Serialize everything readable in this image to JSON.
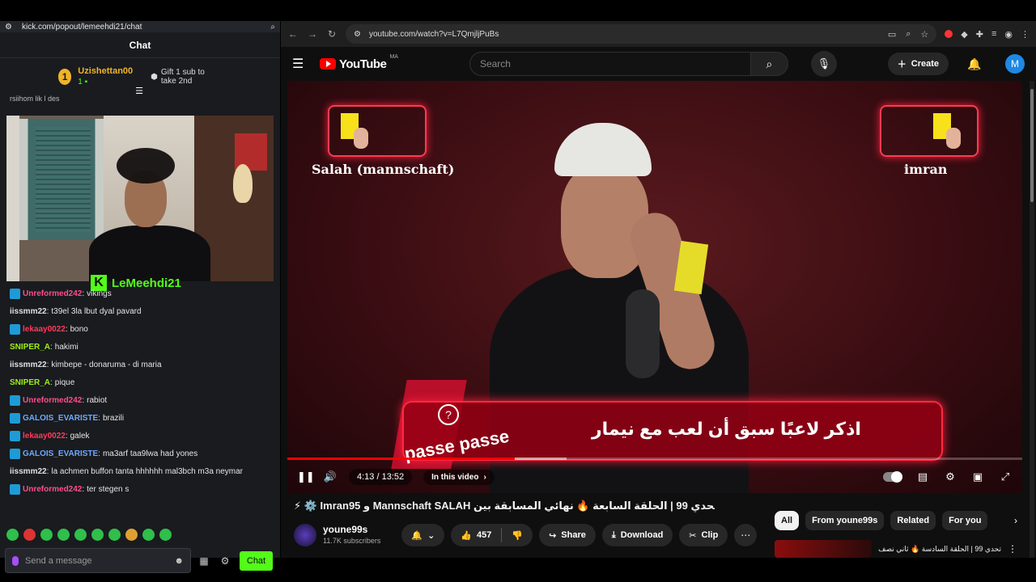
{
  "kick": {
    "url": "kick.com/popout/lemeehdi21/chat",
    "header_title": "Chat",
    "gift": {
      "rank": "1",
      "user": "Uzishettan00",
      "count": "1",
      "cta": "Gift 1 sub to take 2nd"
    },
    "cut_line": "rsiihom lik l des",
    "streamer_tag": "LeMeehdi21",
    "messages": [
      {
        "user": "Unreformed242",
        "text": "vikings",
        "color": "#ff4d8d",
        "badge": true
      },
      {
        "user": "iissmm22",
        "text": "t39el 3la lbut dyal pavard",
        "color": "#e0e0e0",
        "badge": false
      },
      {
        "user": "lekaay0022",
        "text": "bono",
        "color": "#ff3b5c",
        "badge": true
      },
      {
        "user": "SNIPER_A",
        "text": "hakimi",
        "color": "#9ef01a",
        "badge": false
      },
      {
        "user": "iissmm22",
        "text": "kimbepe - donaruma - di maria",
        "color": "#e0e0e0",
        "badge": false
      },
      {
        "user": "SNIPER_A",
        "text": "pique",
        "color": "#9ef01a",
        "badge": false
      },
      {
        "user": "Unreformed242",
        "text": "rabiot",
        "color": "#ff4d8d",
        "badge": true
      },
      {
        "user": "GALOIS_EVARISTE",
        "text": "brazili",
        "color": "#6fa8ff",
        "badge": true
      },
      {
        "user": "lekaay0022",
        "text": "galek",
        "color": "#ff3b5c",
        "badge": true
      },
      {
        "user": "GALOIS_EVARISTE",
        "text": "ma3arf taa9lwa had yones",
        "color": "#6fa8ff",
        "badge": true
      },
      {
        "user": "iissmm22",
        "text": "la achmen buffon tanta hhhhhh mal3bch m3a neymar",
        "color": "#e0e0e0",
        "badge": false
      },
      {
        "user": "Unreformed242",
        "text": "ter stegen s",
        "color": "#ff4d8d",
        "badge": true
      }
    ],
    "input_placeholder": "Send a message",
    "send_label": "Chat"
  },
  "chrome": {
    "url": "youtube.com/watch?v=L7QmjljPuBs"
  },
  "youtube": {
    "logo_text": "YouTube",
    "region": "MA",
    "search_placeholder": "Search",
    "create_label": "Create",
    "avatar_letter": "M",
    "video": {
      "left_label": "Salah (mannschaft)",
      "right_label": "imran",
      "question": "اذكر لاعبًا سبق أن لعب مع نيمار",
      "passe": "passe passe",
      "time": "4:13 / 13:52",
      "chapter": "In this video",
      "progress": 0.31,
      "buffered": 0.38
    },
    "title": "⚡ ⚙️ Imran95 و Mannschaft SALAH تحدي 99 | الحلقة السابعة 🔥 نهائي المسابقة بين",
    "channel": {
      "name": "youne99s",
      "subs": "11.7K subscribers"
    },
    "likes": "457",
    "share_label": "Share",
    "download_label": "Download",
    "clip_label": "Clip",
    "chips": [
      "All",
      "From youne99s",
      "Related",
      "For you"
    ],
    "rec_title": "تحدي 99 | الحلقة السادسة 🔥 ثاني نصف"
  }
}
